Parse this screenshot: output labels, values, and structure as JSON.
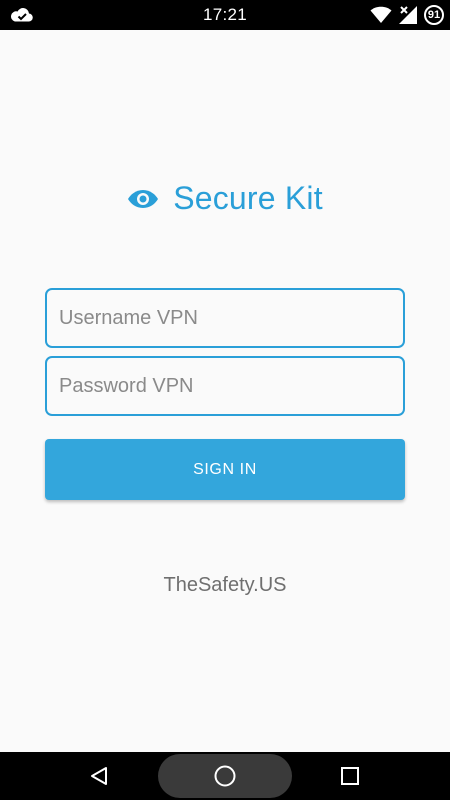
{
  "status_bar": {
    "time": "17:21",
    "battery_level": "91",
    "icons": [
      "cloud-check-icon",
      "wifi-icon",
      "signal-icon",
      "battery-icon"
    ]
  },
  "brand": {
    "title": "Secure Kit",
    "icon": "eye-icon",
    "color": "#2a9fd8"
  },
  "form": {
    "username_placeholder": "Username VPN",
    "username_value": "",
    "password_placeholder": "Password VPN",
    "password_value": "",
    "sign_in_label": "SIGN IN",
    "button_color": "#33a6dc"
  },
  "footer": {
    "text": "TheSafety.US"
  },
  "nav_bar": {
    "icons": [
      "back-icon",
      "home-icon",
      "recents-icon"
    ]
  }
}
